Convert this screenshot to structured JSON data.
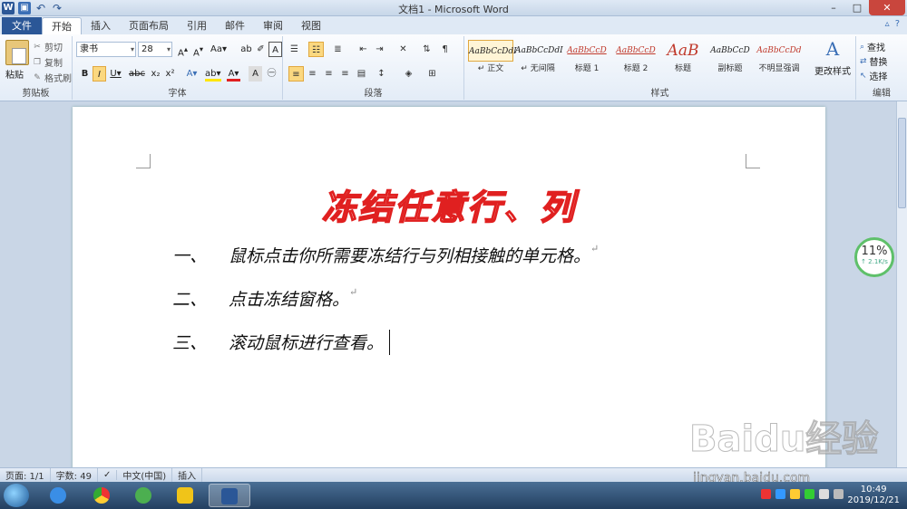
{
  "window": {
    "title": "文档1 - Microsoft Word"
  },
  "qat": {
    "app_icon": "W"
  },
  "tabs": [
    "文件",
    "开始",
    "插入",
    "页面布局",
    "引用",
    "邮件",
    "审阅",
    "视图"
  ],
  "clipboard": {
    "paste": "粘贴",
    "cut": "剪切",
    "copy": "复制",
    "format_painter": "格式刷",
    "group_label": "剪贴板"
  },
  "font": {
    "name": "隶书",
    "size": "28",
    "group_label": "字体"
  },
  "paragraph": {
    "group_label": "段落"
  },
  "styles": {
    "items": [
      {
        "sample": "AaBbCcDdI",
        "name": "↵ 正文"
      },
      {
        "sample": "AaBbCcDdI",
        "name": "↵ 无间隔"
      },
      {
        "sample": "AaBbCcD",
        "name": "标题 1"
      },
      {
        "sample": "AaBbCcD",
        "name": "标题 2"
      },
      {
        "sample": "AaB",
        "name": "标题"
      },
      {
        "sample": "AaBbCcD",
        "name": "副标题"
      },
      {
        "sample": "AaBbCcDd",
        "name": "不明显强调"
      }
    ],
    "change_styles": "更改样式",
    "group_label": "样式"
  },
  "editing": {
    "find": "查找",
    "replace": "替换",
    "select": "选择",
    "group_label": "编辑"
  },
  "document": {
    "title": "冻结任意行、列",
    "lines": [
      {
        "num": "一、",
        "text": "鼠标点击你所需要冻结行与列相接触的单元格。"
      },
      {
        "num": "二、",
        "text": "点击冻结窗格。"
      },
      {
        "num": "三、",
        "text": "滚动鼠标进行查看。"
      }
    ]
  },
  "speed_widget": {
    "percent": "11%",
    "rate": "↑ 2.1K/s"
  },
  "status": {
    "page": "页面: 1/1",
    "words": "字数: 49",
    "language": "中文(中国)",
    "mode": "插入"
  },
  "clock": {
    "time": "10:49",
    "date": "2019/12/21"
  },
  "watermark": {
    "text": "Baidu经验",
    "sub": "jingyan.baidu.com"
  }
}
